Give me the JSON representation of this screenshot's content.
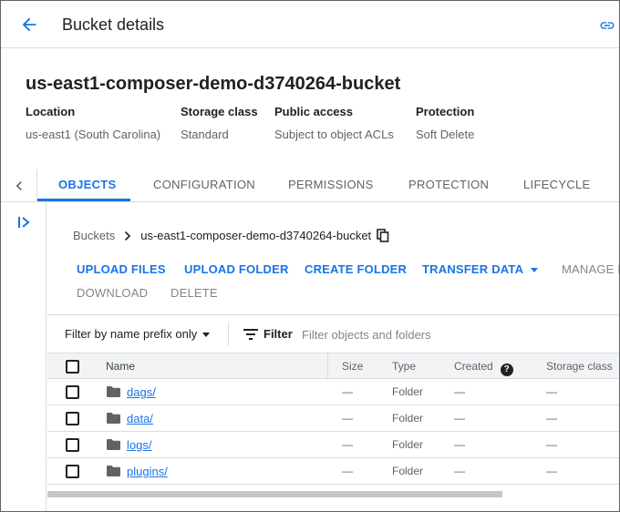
{
  "header": {
    "title": "Bucket details"
  },
  "bucket": {
    "name": "us-east1-composer-demo-d3740264-bucket",
    "meta": [
      {
        "label": "Location",
        "value": "us-east1 (South Carolina)"
      },
      {
        "label": "Storage class",
        "value": "Standard"
      },
      {
        "label": "Public access",
        "value": "Subject to object ACLs"
      },
      {
        "label": "Protection",
        "value": "Soft Delete"
      }
    ]
  },
  "tabs": [
    {
      "label": "OBJECTS",
      "active": true
    },
    {
      "label": "CONFIGURATION"
    },
    {
      "label": "PERMISSIONS"
    },
    {
      "label": "PROTECTION"
    },
    {
      "label": "LIFECYCLE"
    }
  ],
  "breadcrumb": {
    "root": "Buckets",
    "current": "us-east1-composer-demo-d3740264-bucket"
  },
  "actions": {
    "upload_files": "UPLOAD FILES",
    "upload_folder": "UPLOAD FOLDER",
    "create_folder": "CREATE FOLDER",
    "transfer_data": "TRANSFER DATA",
    "manage": "MANAGE H",
    "download": "DOWNLOAD",
    "delete": "DELETE"
  },
  "filter": {
    "mode": "Filter by name prefix only",
    "label": "Filter",
    "placeholder": "Filter objects and folders"
  },
  "table": {
    "columns": [
      "Name",
      "Size",
      "Type",
      "Created",
      "Storage class"
    ],
    "rows": [
      {
        "name": "dags/",
        "size": "—",
        "type": "Folder",
        "created": "—",
        "storage": "—"
      },
      {
        "name": "data/",
        "size": "—",
        "type": "Folder",
        "created": "—",
        "storage": "—"
      },
      {
        "name": "logs/",
        "size": "—",
        "type": "Folder",
        "created": "—",
        "storage": "—"
      },
      {
        "name": "plugins/",
        "size": "—",
        "type": "Folder",
        "created": "—",
        "storage": "—"
      }
    ]
  },
  "colors": {
    "accent": "#1a73e8",
    "text": "#202124",
    "muted": "#5f6368",
    "border": "#dadce0"
  },
  "icons": [
    "back-arrow-icon",
    "link-icon",
    "chevron-left-icon",
    "expand-panel-icon",
    "chevron-right-icon",
    "copy-icon",
    "filter-icon",
    "help-icon",
    "folder-icon"
  ]
}
